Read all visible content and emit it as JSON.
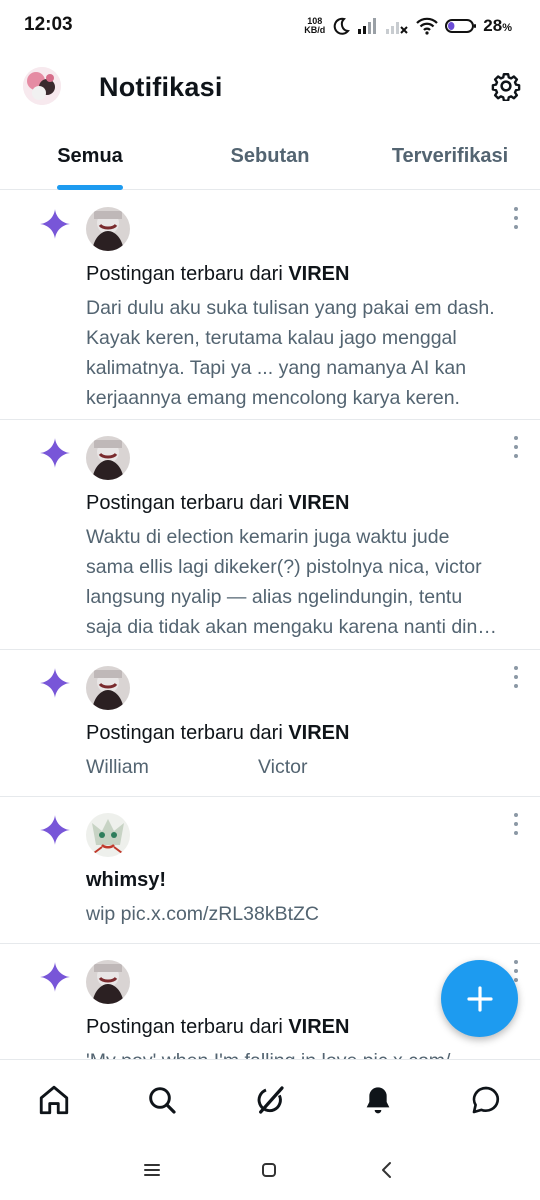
{
  "status_bar": {
    "time": "12:03",
    "net_speed_value": "108",
    "net_speed_unit": "KB/d",
    "battery_percent": "28",
    "battery_unit": "%",
    "battery_level": 0.28
  },
  "header": {
    "title": "Notifikasi",
    "settings_icon": "gear-icon"
  },
  "tabs": [
    {
      "label": "Semua",
      "active": true
    },
    {
      "label": "Sebutan",
      "active": false
    },
    {
      "label": "Terverifikasi",
      "active": false
    }
  ],
  "notifications": [
    {
      "title_prefix": "Postingan terbaru dari ",
      "author": "VIREN",
      "body_lines": [
        "Dari dulu aku suka tulisan yang pakai em dash.",
        "Kayak keren, terutama kalau jago menggal",
        "kalimatnya. Tapi ya ... yang namanya AI kan",
        "kerjaannya emang mencolong karya keren."
      ]
    },
    {
      "title_prefix": "Postingan terbaru dari ",
      "author": "VIREN",
      "body_lines": [
        "Waktu di election kemarin juga waktu jude",
        "sama ellis lagi dikeker(?) pistolnya nica, victor",
        "langsung nyalip — alias ngelindungin, tentu",
        "saja dia tidak akan mengaku karena nanti din…"
      ]
    },
    {
      "title_prefix": "Postingan terbaru dari ",
      "author": "VIREN",
      "body_col1": "William",
      "body_col2": "Victor"
    },
    {
      "title": "whimsy!",
      "body": "wip pic.x.com/zRL38kBtZC"
    },
    {
      "title_prefix": "Postingan terbaru dari ",
      "author": "VIREN",
      "body_partial": "'My pov' when I'm falling in love  pic.x.com/"
    }
  ],
  "fab": {
    "icon": "plus-icon"
  },
  "bottom_nav": [
    "home-icon",
    "search-icon",
    "grok-icon",
    "bell-icon",
    "messages-icon"
  ],
  "colors": {
    "accent": "#1d9bf0",
    "sparkle": "#7856d8",
    "text_primary": "#0f1419",
    "text_secondary": "#536471"
  }
}
